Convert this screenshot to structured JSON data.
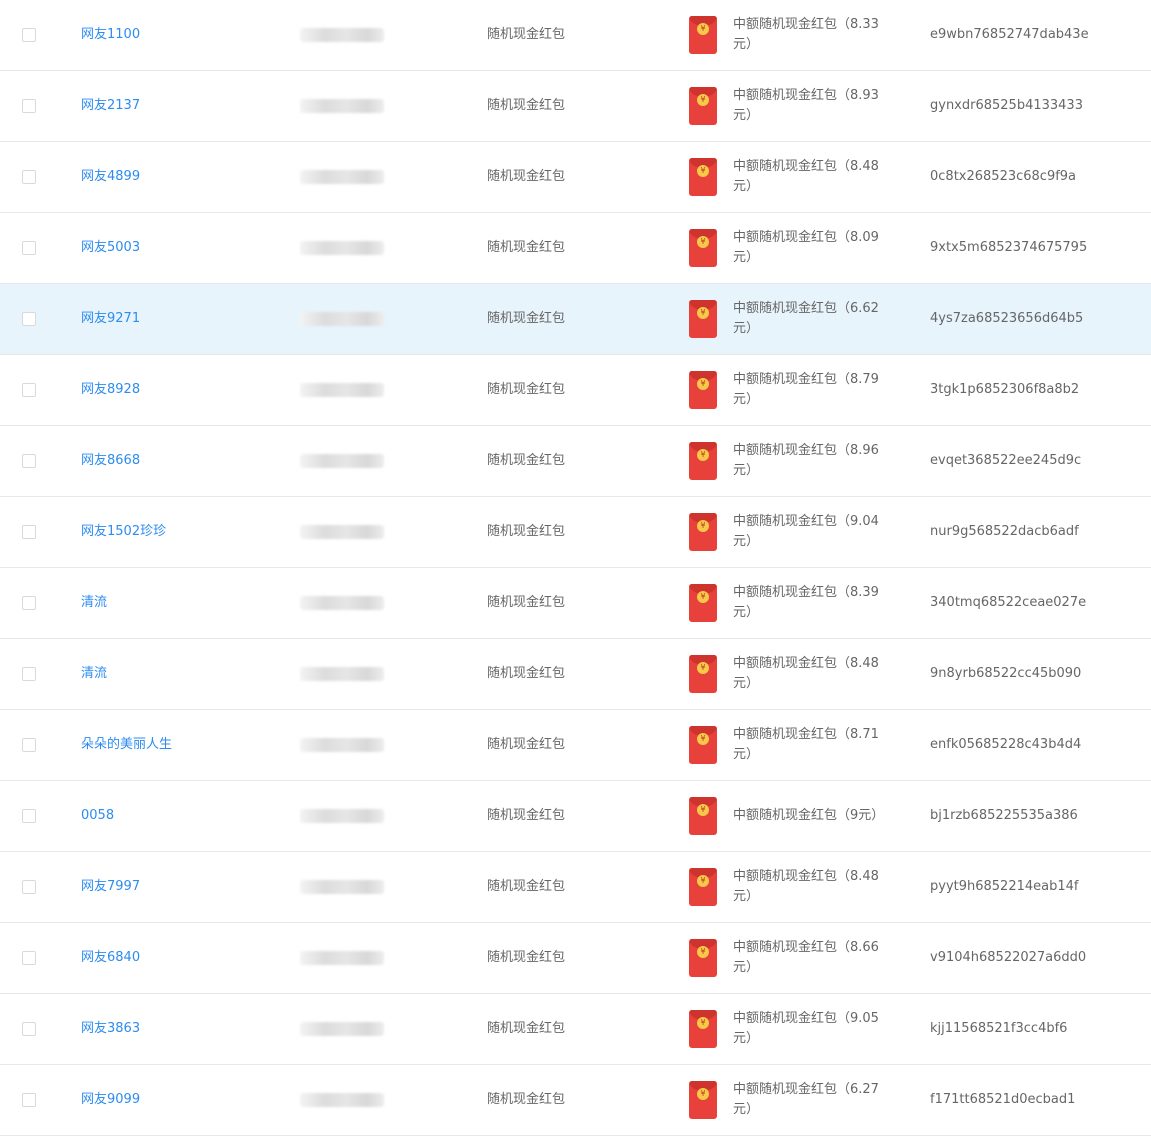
{
  "colors": {
    "link": "#2d8cf0",
    "text": "#666666",
    "row_highlight": "#e8f4fb",
    "envelope_red": "#e8413b",
    "envelope_seal": "#f7c948",
    "border": "#e8e8e8"
  },
  "rows": [
    {
      "name": "网友1100",
      "type": "随机现金红包",
      "prize": "中额随机现金红包（8.33元）",
      "code": "e9wbn76852747dab43e",
      "highlight": false
    },
    {
      "name": "网友2137",
      "type": "随机现金红包",
      "prize": "中额随机现金红包（8.93元）",
      "code": "gynxdr68525b4133433",
      "highlight": false
    },
    {
      "name": "网友4899",
      "type": "随机现金红包",
      "prize": "中额随机现金红包（8.48元）",
      "code": "0c8tx268523c68c9f9a",
      "highlight": false
    },
    {
      "name": "网友5003",
      "type": "随机现金红包",
      "prize": "中额随机现金红包（8.09元）",
      "code": "9xtx5m6852374675795",
      "highlight": false
    },
    {
      "name": "网友9271",
      "type": "随机现金红包",
      "prize": "中额随机现金红包（6.62元）",
      "code": "4ys7za68523656d64b5",
      "highlight": true
    },
    {
      "name": "网友8928",
      "type": "随机现金红包",
      "prize": "中额随机现金红包（8.79元）",
      "code": "3tgk1p6852306f8a8b2",
      "highlight": false
    },
    {
      "name": "网友8668",
      "type": "随机现金红包",
      "prize": "中额随机现金红包（8.96元）",
      "code": "evqet368522ee245d9c",
      "highlight": false
    },
    {
      "name": "网友1502珍珍",
      "type": "随机现金红包",
      "prize": "中额随机现金红包（9.04元）",
      "code": "nur9g568522dacb6adf",
      "highlight": false
    },
    {
      "name": "清流",
      "type": "随机现金红包",
      "prize": "中额随机现金红包（8.39元）",
      "code": "340tmq68522ceae027e",
      "highlight": false
    },
    {
      "name": "清流",
      "type": "随机现金红包",
      "prize": "中额随机现金红包（8.48元）",
      "code": "9n8yrb68522cc45b090",
      "highlight": false
    },
    {
      "name": "朵朵的美丽人生",
      "type": "随机现金红包",
      "prize": "中额随机现金红包（8.71元）",
      "code": "enfk05685228c43b4d4",
      "highlight": false
    },
    {
      "name": "0058",
      "type": "随机现金红包",
      "prize": "中额随机现金红包（9元）",
      "code": "bj1rzb685225535a386",
      "highlight": false
    },
    {
      "name": "网友7997",
      "type": "随机现金红包",
      "prize": "中额随机现金红包（8.48元）",
      "code": "pyyt9h6852214eab14f",
      "highlight": false
    },
    {
      "name": "网友6840",
      "type": "随机现金红包",
      "prize": "中额随机现金红包（8.66元）",
      "code": "v9104h68522027a6dd0",
      "highlight": false
    },
    {
      "name": "网友3863",
      "type": "随机现金红包",
      "prize": "中额随机现金红包（9.05元）",
      "code": "kjj11568521f3cc4bf6",
      "highlight": false
    },
    {
      "name": "网友9099",
      "type": "随机现金红包",
      "prize": "中额随机现金红包（6.27元）",
      "code": "f171tt68521d0ecbad1",
      "highlight": false
    }
  ]
}
